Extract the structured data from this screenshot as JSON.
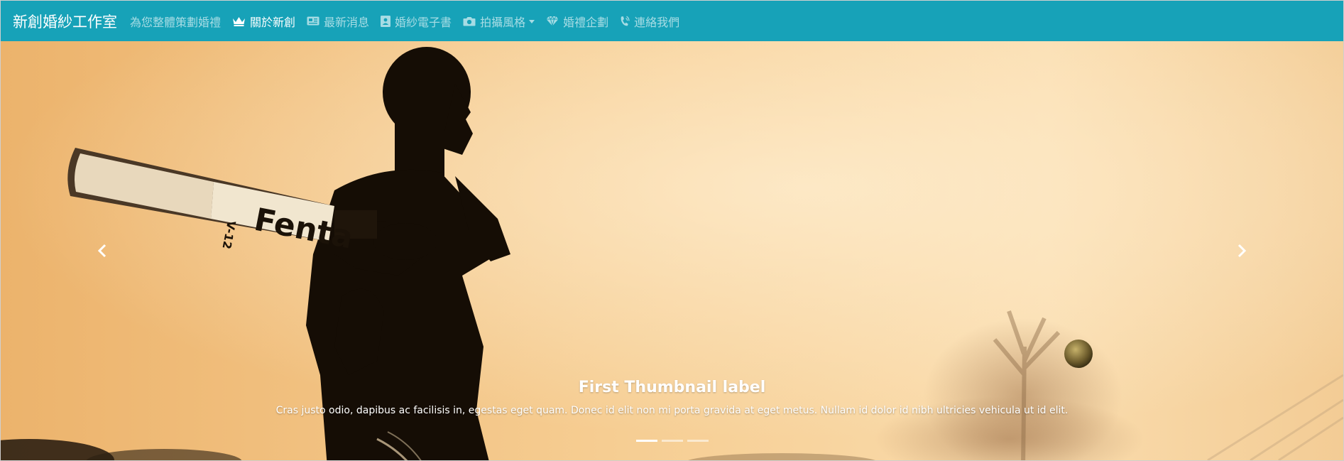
{
  "navbar": {
    "brand": "新創婚紗工作室",
    "accent_color": "#17a2b8",
    "items": [
      {
        "label": "為您整體策劃婚禮",
        "icon": "",
        "active": false,
        "dropdown": false
      },
      {
        "label": "關於新創",
        "icon": "crown-icon",
        "active": true,
        "dropdown": false
      },
      {
        "label": "最新消息",
        "icon": "newspaper-icon",
        "active": false,
        "dropdown": false
      },
      {
        "label": "婚紗電子書",
        "icon": "address-book-icon",
        "active": false,
        "dropdown": false
      },
      {
        "label": "拍攝風格",
        "icon": "camera-icon",
        "active": false,
        "dropdown": true
      },
      {
        "label": "婚禮企劃",
        "icon": "gem-icon",
        "active": false,
        "dropdown": false
      },
      {
        "label": "連絡我們",
        "icon": "phone-volume-icon",
        "active": false,
        "dropdown": false
      }
    ]
  },
  "carousel": {
    "caption_title": "First Thumbnail label",
    "caption_text": "Cras justo odio, dapibus ac facilisis in, egestas eget quam. Donec id elit non mi porta gravida at eget metus. Nullam id dolor id nibh ultricies vehicula ut id elit.",
    "bat_text": "Fenta",
    "bat_sub": "V-12",
    "indicators": [
      {
        "active": true
      },
      {
        "active": false
      },
      {
        "active": false
      }
    ],
    "prev_icon": "chevron-left-icon",
    "next_icon": "chevron-right-icon"
  }
}
